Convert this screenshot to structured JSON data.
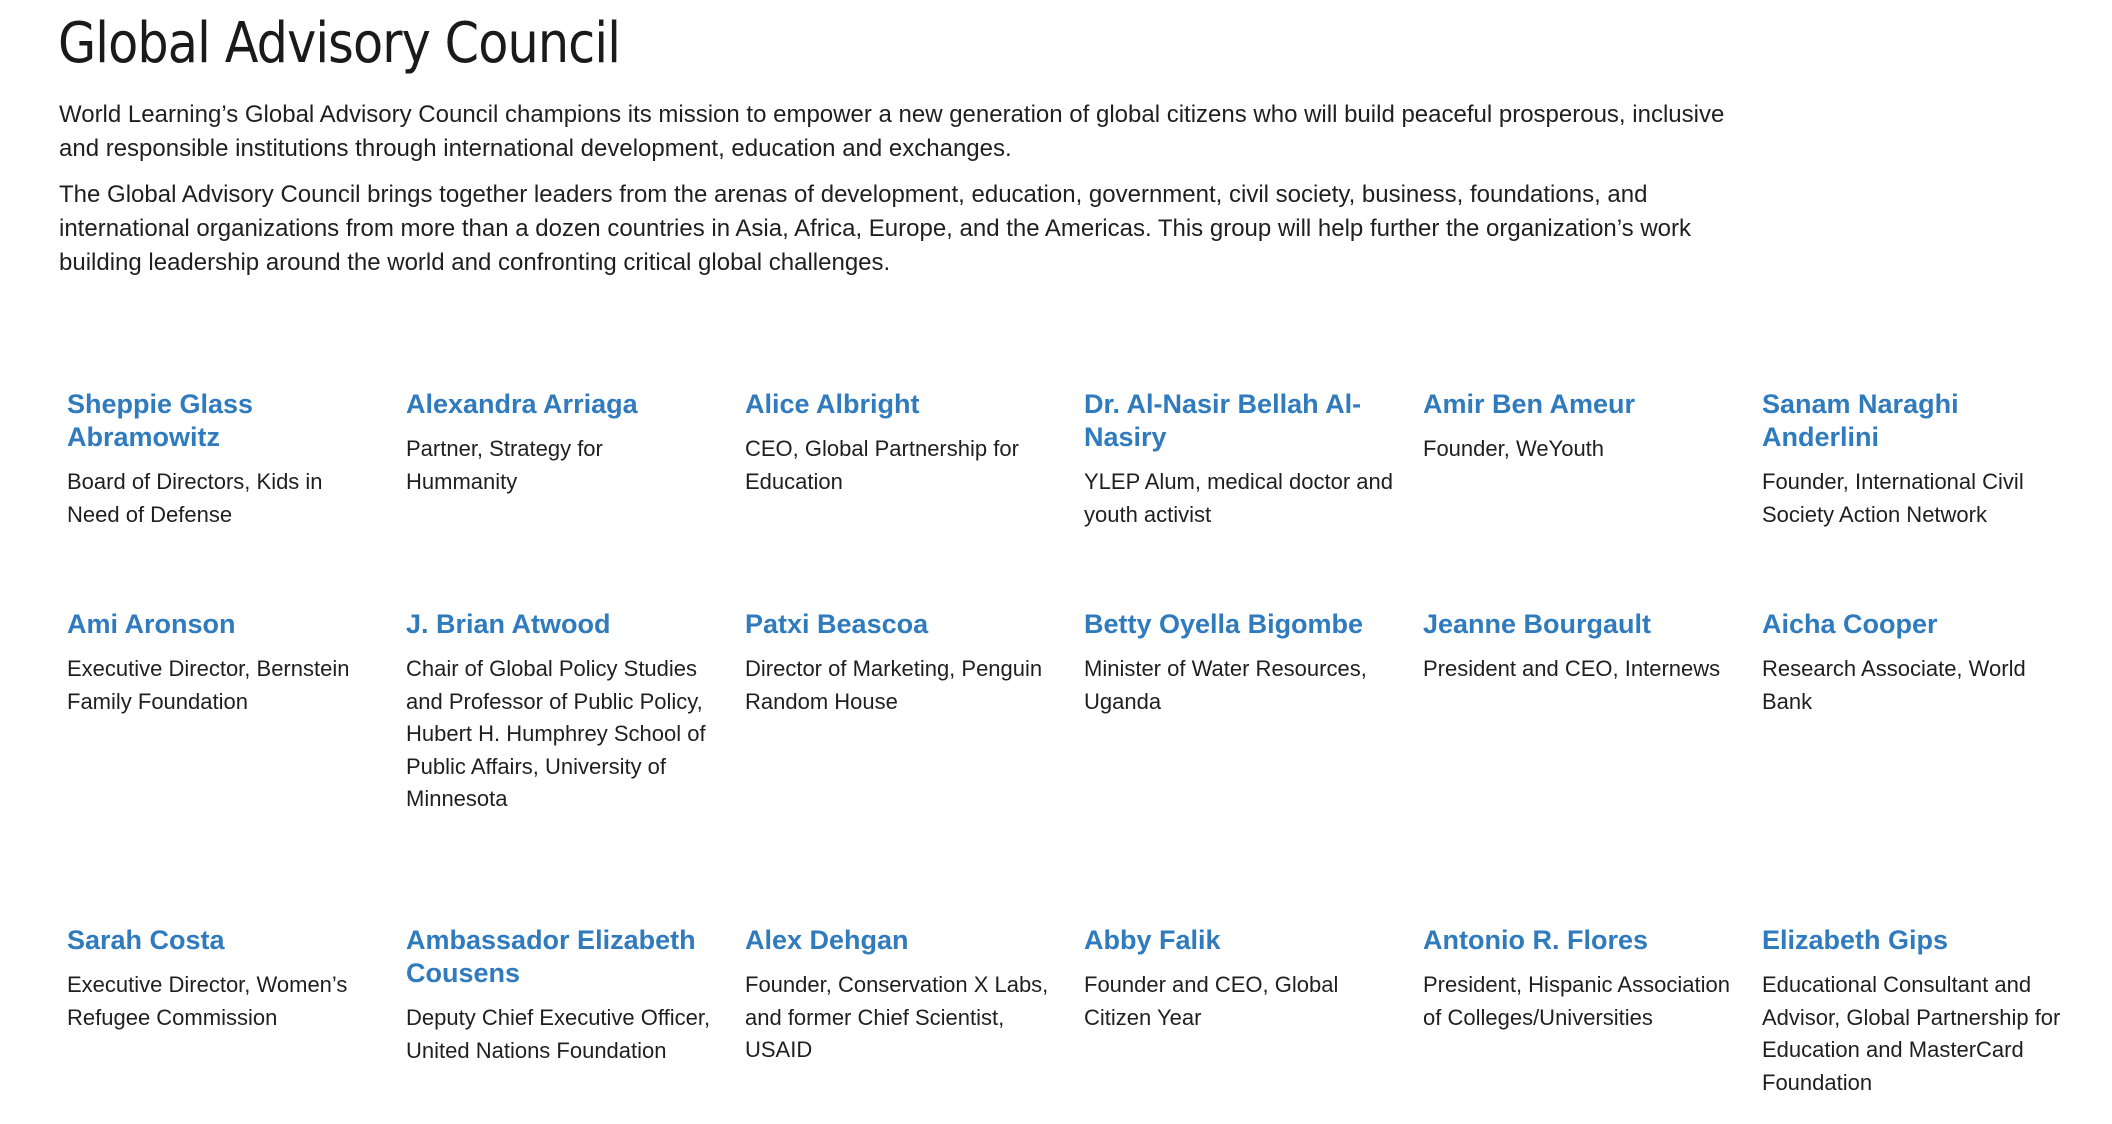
{
  "page": {
    "title": "Global Advisory Council",
    "intro": [
      "World Learning’s Global Advisory Council champions its mission to empower a new generation of global citizens who will build peaceful prosperous, inclusive and responsible institutions through international development, education and exchanges.",
      "The Global Advisory Council brings together leaders from the arenas of development, education, government, civil society, business, foundations, and international organizations from more than a dozen countries in Asia, Africa, Europe, and the Americas. This group will help further the organization’s work building leadership around the world and confronting critical global challenges."
    ]
  },
  "members": [
    {
      "name": "Sheppie Glass Abramowitz",
      "role": "Board of Directors, Kids in Need of Defense"
    },
    {
      "name": "Alexandra Arriaga",
      "role": "Partner, Strategy for Hummanity"
    },
    {
      "name": "Alice Albright",
      "role": "CEO, Global Partnership for Education"
    },
    {
      "name": "Dr. Al-Nasir Bellah Al-Nasiry",
      "role": "YLEP Alum, medical doctor and youth activist"
    },
    {
      "name": "Amir Ben Ameur",
      "role": "Founder, WeYouth"
    },
    {
      "name": "Sanam Naraghi Anderlini",
      "role": "Founder, International Civil Society Action Network"
    },
    {
      "name": "Ami Aronson",
      "role": "Executive Director, Bernstein Family Foundation"
    },
    {
      "name": "J. Brian Atwood",
      "role": "Chair of Global Policy Studies and Professor of Public Policy, Hubert H. Humphrey School of Public Affairs, University of Minnesota"
    },
    {
      "name": "Patxi Beascoa",
      "role": "Director of Marketing, Penguin Random House"
    },
    {
      "name": "Betty Oyella Bigombe",
      "role": "Minister of Water Resources, Uganda"
    },
    {
      "name": "Jeanne Bourgault",
      "role": "President and CEO, Internews"
    },
    {
      "name": "Aicha Cooper",
      "role": "Research Associate, World Bank"
    },
    {
      "name": "Sarah Costa",
      "role": "Executive Director, Women’s Refugee Commission"
    },
    {
      "name": "Ambassador Elizabeth Cousens",
      "role": "Deputy Chief Executive Officer, United Nations Foundation"
    },
    {
      "name": "Alex Dehgan",
      "role": "Founder, Conservation X Labs, and former Chief Scientist, USAID"
    },
    {
      "name": "Abby Falik",
      "role": "Founder and CEO, Global Citizen Year"
    },
    {
      "name": "Antonio R. Flores",
      "role": "President, Hispanic Association of Colleges/Universities"
    },
    {
      "name": "Elizabeth Gips",
      "role": "Educational Consultant and Advisor, Global Partnership for Education and MasterCard Foundation"
    }
  ],
  "colors": {
    "accent": "#2f7bbd",
    "text": "#1f1f1f",
    "background": "#ffffff"
  }
}
